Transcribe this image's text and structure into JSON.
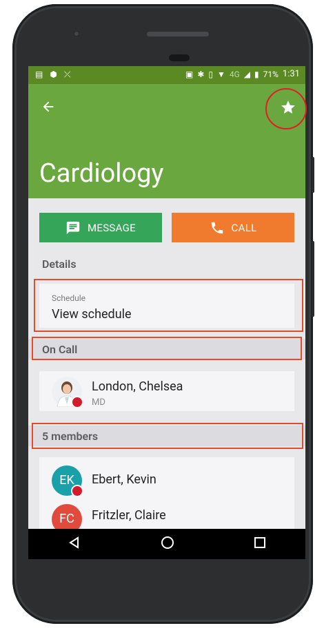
{
  "status_bar": {
    "battery": "71%",
    "time": "1:31",
    "network": "4G"
  },
  "header": {
    "title": "Cardiology"
  },
  "actions": {
    "message_label": "MESSAGE",
    "call_label": "CALL"
  },
  "details": {
    "section_label": "Details",
    "schedule": {
      "sublabel": "Schedule",
      "value": "View schedule"
    }
  },
  "on_call": {
    "section_label": "On Call",
    "person": {
      "name": "London, Chelsea",
      "role": "MD"
    }
  },
  "members": {
    "section_label": "5 members",
    "items": [
      {
        "initials": "EK",
        "name": "Ebert, Kevin",
        "color": "#1aa0a8"
      },
      {
        "initials": "FC",
        "name": "Fritzler, Claire",
        "color": "#e04b3d"
      }
    ]
  },
  "colors": {
    "appbar": "#6aa73f",
    "message": "#35a55a",
    "call": "#f07a2d",
    "annotation": "#e24c28"
  }
}
